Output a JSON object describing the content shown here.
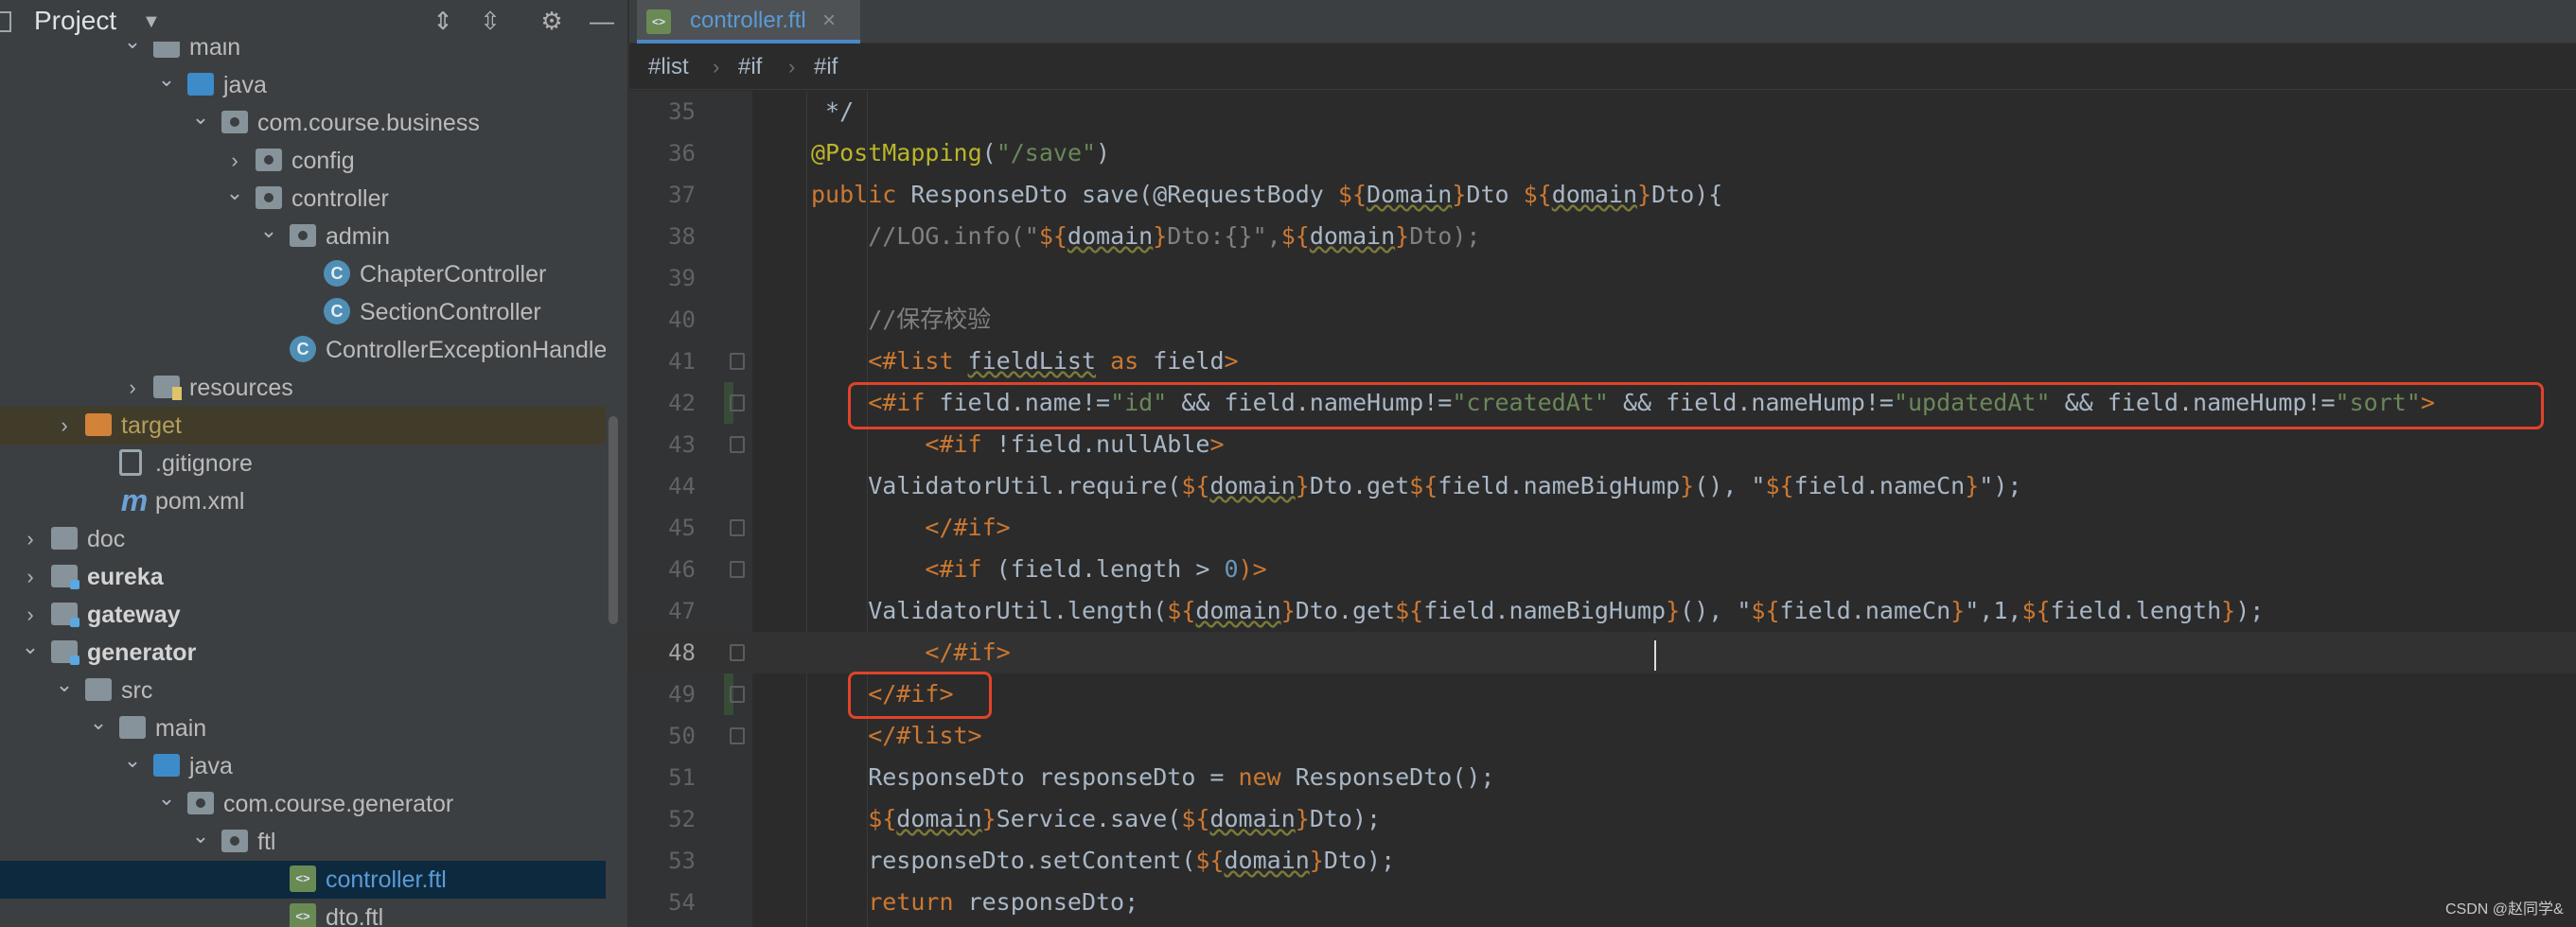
{
  "window": {
    "project_label": "Project"
  },
  "tree": [
    {
      "label": "main",
      "kind": "folder",
      "depth": 4,
      "arrow": "down",
      "cut": true
    },
    {
      "label": "java",
      "kind": "folder-blue",
      "depth": 5,
      "arrow": "down"
    },
    {
      "label": "com.course.business",
      "kind": "package",
      "depth": 6,
      "arrow": "down"
    },
    {
      "label": "config",
      "kind": "package",
      "depth": 7,
      "arrow": "right"
    },
    {
      "label": "controller",
      "kind": "package",
      "depth": 7,
      "arrow": "down"
    },
    {
      "label": "admin",
      "kind": "package",
      "depth": 8,
      "arrow": "down"
    },
    {
      "label": "ChapterController",
      "kind": "class",
      "depth": 9
    },
    {
      "label": "SectionController",
      "kind": "class",
      "depth": 9
    },
    {
      "label": "ControllerExceptionHandle",
      "kind": "class",
      "depth": 8
    },
    {
      "label": "resources",
      "kind": "resources",
      "depth": 4,
      "arrow": "right"
    },
    {
      "label": "target",
      "kind": "folder-orange",
      "depth": 2,
      "arrow": "right",
      "style": "orange",
      "highlight": "dim"
    },
    {
      "label": ".gitignore",
      "kind": "gitignore",
      "depth": 3
    },
    {
      "label": "pom.xml",
      "kind": "maven",
      "depth": 3
    },
    {
      "label": "doc",
      "kind": "folder",
      "depth": 1,
      "arrow": "right"
    },
    {
      "label": "eureka",
      "kind": "module",
      "depth": 1,
      "arrow": "right",
      "style": "bold"
    },
    {
      "label": "gateway",
      "kind": "module",
      "depth": 1,
      "arrow": "right",
      "style": "bold"
    },
    {
      "label": "generator",
      "kind": "module",
      "depth": 1,
      "arrow": "down",
      "style": "bold"
    },
    {
      "label": "src",
      "kind": "folder",
      "depth": 2,
      "arrow": "down"
    },
    {
      "label": "main",
      "kind": "folder",
      "depth": 3,
      "arrow": "down"
    },
    {
      "label": "java",
      "kind": "folder-blue",
      "depth": 4,
      "arrow": "down"
    },
    {
      "label": "com.course.generator",
      "kind": "package",
      "depth": 5,
      "arrow": "down"
    },
    {
      "label": "ftl",
      "kind": "package",
      "depth": 6,
      "arrow": "down"
    },
    {
      "label": "controller.ftl",
      "kind": "ftl",
      "depth": 8,
      "style": "blue",
      "highlight": "selected"
    },
    {
      "label": "dto.ftl",
      "kind": "ftl",
      "depth": 8
    }
  ],
  "editor": {
    "tab_label": "controller.ftl",
    "tab_close": "×",
    "breadcrumbs": [
      "#list",
      "#if",
      "#if"
    ],
    "current_line": 48,
    "lines": [
      {
        "n": "35",
        "indent": 9,
        "segs": [
          [
            "*/",
            "i"
          ]
        ]
      },
      {
        "n": "36",
        "indent": 8,
        "segs": [
          [
            "@PostMapping",
            "a"
          ],
          [
            "(",
            "i"
          ],
          [
            "\"/save\"",
            "s"
          ],
          [
            ")",
            "i"
          ]
        ]
      },
      {
        "n": "37",
        "indent": 8,
        "segs": [
          [
            "public ",
            "k"
          ],
          [
            "ResponseDto save(@RequestBody ",
            "i"
          ],
          [
            "${",
            "k"
          ],
          [
            "Domain",
            "iu"
          ],
          [
            "}",
            "k"
          ],
          [
            "Dto ",
            "i"
          ],
          [
            "${",
            "k"
          ],
          [
            "domain",
            "iu"
          ],
          [
            "}",
            "k"
          ],
          [
            "Dto){",
            "i"
          ]
        ]
      },
      {
        "n": "38",
        "indent": 12,
        "segs": [
          [
            "//LOG.info(\"",
            "c"
          ],
          [
            "${",
            "k"
          ],
          [
            "domain",
            "iu"
          ],
          [
            "}",
            "k"
          ],
          [
            "Dto:{}\",",
            "c"
          ],
          [
            "${",
            "k"
          ],
          [
            "domain",
            "iu"
          ],
          [
            "}",
            "k"
          ],
          [
            "Dto);",
            "c"
          ]
        ]
      },
      {
        "n": "39",
        "indent": 0,
        "segs": []
      },
      {
        "n": "40",
        "indent": 12,
        "segs": [
          [
            "//保存校验",
            "c"
          ]
        ]
      },
      {
        "n": "41",
        "indent": 12,
        "fold": true,
        "segs": [
          [
            "<#list ",
            "k"
          ],
          [
            "fieldList",
            "iu"
          ],
          [
            " as ",
            "k"
          ],
          [
            "field",
            "i"
          ],
          [
            ">",
            "k"
          ]
        ]
      },
      {
        "n": "42",
        "indent": 12,
        "fold": true,
        "change": true,
        "segs": [
          [
            "<#if ",
            "k"
          ],
          [
            "field.name!=",
            "i"
          ],
          [
            "\"id\"",
            "s"
          ],
          [
            " && field.nameHump!=",
            "i"
          ],
          [
            "\"createdAt\"",
            "s"
          ],
          [
            " && field.nameHump!=",
            "i"
          ],
          [
            "\"updatedAt\"",
            "s"
          ],
          [
            " && field.nameHump!=",
            "i"
          ],
          [
            "\"sort\"",
            "s"
          ],
          [
            ">",
            "k"
          ]
        ]
      },
      {
        "n": "43",
        "indent": 16,
        "fold": true,
        "segs": [
          [
            "<#if ",
            "k"
          ],
          [
            "!field.nullAble",
            "i"
          ],
          [
            ">",
            "k"
          ]
        ]
      },
      {
        "n": "44",
        "indent": 12,
        "segs": [
          [
            "ValidatorUtil.require(",
            "i"
          ],
          [
            "${",
            "k"
          ],
          [
            "domain",
            "iu"
          ],
          [
            "}",
            "k"
          ],
          [
            "Dto.get",
            "i"
          ],
          [
            "${",
            "k"
          ],
          [
            "field.nameBigHump",
            "i"
          ],
          [
            "}",
            "k"
          ],
          [
            "(), \"",
            "i"
          ],
          [
            "${",
            "k"
          ],
          [
            "field.nameCn",
            "i"
          ],
          [
            "}",
            "k"
          ],
          [
            "\");",
            "i"
          ]
        ]
      },
      {
        "n": "45",
        "indent": 16,
        "fold": true,
        "segs": [
          [
            "</#if>",
            "k"
          ]
        ]
      },
      {
        "n": "46",
        "indent": 16,
        "fold": true,
        "segs": [
          [
            "<#if ",
            "k"
          ],
          [
            "(field.length > ",
            "i"
          ],
          [
            "0",
            "n"
          ],
          [
            ")>",
            "k"
          ]
        ]
      },
      {
        "n": "47",
        "indent": 12,
        "segs": [
          [
            "ValidatorUtil.length(",
            "i"
          ],
          [
            "${",
            "k"
          ],
          [
            "domain",
            "iu"
          ],
          [
            "}",
            "k"
          ],
          [
            "Dto.get",
            "i"
          ],
          [
            "${",
            "k"
          ],
          [
            "field.nameBigHump",
            "i"
          ],
          [
            "}",
            "k"
          ],
          [
            "(), \"",
            "i"
          ],
          [
            "${",
            "k"
          ],
          [
            "field.nameCn",
            "i"
          ],
          [
            "}",
            "k"
          ],
          [
            "\",1,",
            "i"
          ],
          [
            "${",
            "k"
          ],
          [
            "field.length",
            "i"
          ],
          [
            "}",
            "k"
          ],
          [
            ");",
            "i"
          ]
        ]
      },
      {
        "n": "48",
        "indent": 16,
        "fold": true,
        "segs": [
          [
            "</#if>",
            "k"
          ]
        ]
      },
      {
        "n": "49",
        "indent": 12,
        "fold": true,
        "change": true,
        "segs": [
          [
            "</#if>",
            "k"
          ]
        ]
      },
      {
        "n": "50",
        "indent": 12,
        "fold": true,
        "segs": [
          [
            "</#list>",
            "k"
          ]
        ]
      },
      {
        "n": "51",
        "indent": 12,
        "segs": [
          [
            "ResponseDto responseDto = ",
            "i"
          ],
          [
            "new ",
            "k"
          ],
          [
            "ResponseDto();",
            "i"
          ]
        ]
      },
      {
        "n": "52",
        "indent": 12,
        "segs": [
          [
            "${",
            "k"
          ],
          [
            "domain",
            "iu"
          ],
          [
            "}",
            "k"
          ],
          [
            "Service.save(",
            "i"
          ],
          [
            "${",
            "k"
          ],
          [
            "domain",
            "iu"
          ],
          [
            "}",
            "k"
          ],
          [
            "Dto);",
            "i"
          ]
        ]
      },
      {
        "n": "53",
        "indent": 12,
        "segs": [
          [
            "responseDto.setContent(",
            "i"
          ],
          [
            "${",
            "k"
          ],
          [
            "domain",
            "iu"
          ],
          [
            "}",
            "k"
          ],
          [
            "Dto);",
            "i"
          ]
        ]
      },
      {
        "n": "54",
        "indent": 12,
        "segs": [
          [
            "return ",
            "k"
          ],
          [
            "responseDto;",
            "i"
          ]
        ]
      }
    ]
  },
  "watermark": "CSDN @赵同学&",
  "colors": {
    "keyword": "#cc7832",
    "string": "#6a8759",
    "number": "#6897bb",
    "comment": "#808080",
    "annotation": "#bbb529",
    "highlight_box": "#e0432a"
  }
}
